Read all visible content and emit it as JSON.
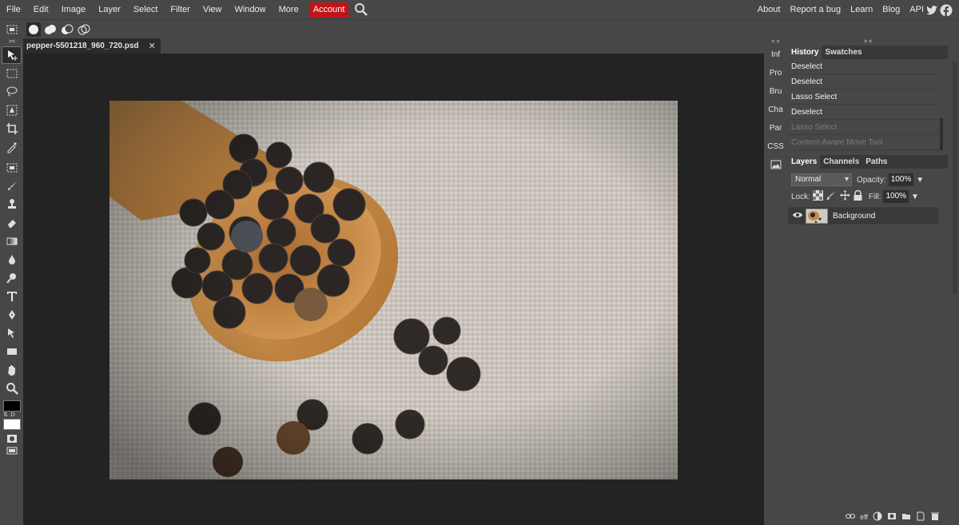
{
  "menu": {
    "items": [
      "File",
      "Edit",
      "Image",
      "Layer",
      "Select",
      "Filter",
      "View",
      "Window",
      "More"
    ],
    "account": "Account",
    "right": [
      "About",
      "Report a bug",
      "Learn",
      "Blog",
      "API"
    ]
  },
  "options": {
    "collapse": "> <"
  },
  "tools": [
    "move",
    "marquee",
    "lasso",
    "object-select",
    "crop",
    "eyedropper",
    "marquee-alt",
    "brush",
    "stamp",
    "eraser",
    "gradient",
    "blur",
    "dodge",
    "text",
    "pen",
    "path-select",
    "shape",
    "hand",
    "zoom"
  ],
  "document": {
    "tab_name": "pepper-5501218_960_720.psd",
    "close": "✕"
  },
  "mini_panels": {
    "header": "< >",
    "items": [
      "Inf",
      "Pro",
      "Bru",
      "Cha",
      "Par",
      "CSS"
    ]
  },
  "history": {
    "header": "> <",
    "tabs": [
      "History",
      "Swatches"
    ],
    "rows": [
      {
        "label": "Deselect",
        "dim": false
      },
      {
        "label": "Deselect",
        "dim": false
      },
      {
        "label": "Lasso Select",
        "dim": false
      },
      {
        "label": "Deselect",
        "dim": false
      },
      {
        "label": "Lasso Select",
        "dim": true
      },
      {
        "label": "Content-Aware Move Tool",
        "dim": true
      }
    ]
  },
  "layers": {
    "tabs": [
      "Layers",
      "Channels",
      "Paths"
    ],
    "blend_mode": "Normal",
    "opacity_label": "Opacity:",
    "opacity_value": "100%",
    "lock_label": "Lock:",
    "fill_label": "Fill:",
    "fill_value": "100%",
    "layer_name": "Background",
    "footer_eff": "eff"
  },
  "colors": {
    "accent": "#c0141a",
    "panel": "#474747",
    "workspace": "#232323"
  }
}
